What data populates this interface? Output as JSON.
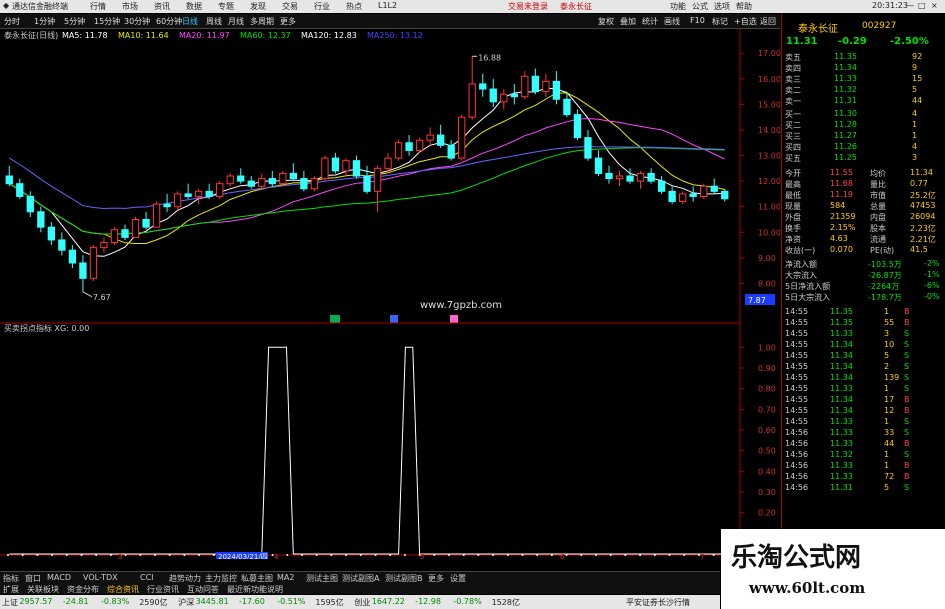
{
  "topbar": {
    "app_name": "通达信金融终端",
    "menus": [
      "行情",
      "市场",
      "资讯",
      "数据",
      "专题",
      "发现",
      "交易",
      "行业",
      "热点"
    ],
    "build": "L1L2",
    "links": [
      "交易未登录",
      "泰永长征"
    ],
    "right_menus": [
      "功能",
      "公式",
      "选项",
      "帮助"
    ],
    "time": "20:31:23",
    "window_controls": [
      "—",
      "□",
      "×"
    ]
  },
  "tabs": {
    "items": [
      "分时",
      "1分钟",
      "5分钟",
      "15分钟",
      "30分钟",
      "60分钟",
      "日线",
      "周线",
      "月线",
      "多周期",
      "更多"
    ],
    "right_items": [
      "复权",
      "叠加",
      "统计",
      "画线",
      "F10",
      "标记",
      "+自选",
      "返回"
    ]
  },
  "chart_header": {
    "title": "泰永长征(日线)",
    "ma": [
      {
        "label": "MA5: 11.78",
        "color": "#ffffff"
      },
      {
        "label": "MA10: 11.64",
        "color": "#e8e800"
      },
      {
        "label": "MA20: 11.97",
        "color": "#ff44ff"
      },
      {
        "label": "MA60: 12.37",
        "color": "#00e000"
      },
      {
        "label": "MA120: 12.83",
        "color": "#ffffff"
      },
      {
        "label": "MA250: 13.12",
        "color": "#4444ff"
      }
    ]
  },
  "indicator_header": {
    "title": "买卖拐点指标",
    "value": "XG: 0.00"
  },
  "price_labels": {
    "high": "16.88",
    "low": "7.67",
    "cursor_price": "7.87"
  },
  "site_watermark": "www.7gpzb.com",
  "time_axis": {
    "start": "2024年",
    "cursor_date": "2024/03/21/四",
    "ticks": [
      "3",
      "4",
      "5",
      "6",
      "7"
    ]
  },
  "price_axis": [
    "17.00",
    "16.00",
    "15.00",
    "14.00",
    "13.00",
    "12.00",
    "11.00",
    "10.00",
    "9.00",
    "8.00"
  ],
  "indicator_axis": [
    "1.00",
    "0.90",
    "0.80",
    "0.70",
    "0.60",
    "0.50",
    "0.40",
    "0.30",
    "0.20",
    "0.10"
  ],
  "chart_data": {
    "type": "candlestick",
    "price_ylim": [
      7.0,
      17.4
    ],
    "ohlc": [
      [
        12.2,
        12.6,
        11.8,
        11.9
      ],
      [
        11.9,
        12.1,
        11.3,
        11.4
      ],
      [
        11.4,
        11.6,
        10.6,
        10.8
      ],
      [
        10.8,
        11.0,
        10.0,
        10.2
      ],
      [
        10.2,
        10.4,
        9.5,
        9.7
      ],
      [
        9.7,
        10.0,
        9.1,
        9.3
      ],
      [
        9.3,
        9.5,
        8.6,
        8.8
      ],
      [
        8.8,
        9.1,
        7.67,
        8.2
      ],
      [
        8.2,
        9.5,
        8.1,
        9.4
      ],
      [
        9.4,
        9.8,
        9.2,
        9.6
      ],
      [
        9.6,
        10.2,
        9.5,
        10.1
      ],
      [
        10.1,
        10.3,
        9.7,
        9.8
      ],
      [
        9.8,
        10.6,
        9.8,
        10.5
      ],
      [
        10.5,
        10.8,
        10.1,
        10.2
      ],
      [
        10.2,
        11.2,
        10.2,
        11.1
      ],
      [
        11.1,
        11.5,
        10.8,
        11.0
      ],
      [
        11.0,
        11.6,
        10.9,
        11.5
      ],
      [
        11.5,
        11.9,
        11.3,
        11.4
      ],
      [
        11.4,
        11.7,
        11.1,
        11.6
      ],
      [
        11.6,
        11.9,
        11.3,
        11.4
      ],
      [
        11.4,
        12.0,
        11.3,
        11.9
      ],
      [
        11.9,
        12.3,
        11.8,
        12.2
      ],
      [
        12.2,
        12.5,
        11.9,
        12.0
      ],
      [
        12.0,
        12.2,
        11.7,
        11.8
      ],
      [
        11.8,
        12.3,
        11.7,
        12.1
      ],
      [
        12.1,
        12.4,
        11.8,
        11.9
      ],
      [
        11.9,
        12.4,
        11.8,
        12.3
      ],
      [
        12.3,
        12.7,
        12.0,
        12.1
      ],
      [
        12.1,
        12.4,
        11.6,
        11.7
      ],
      [
        11.7,
        12.2,
        11.6,
        12.1
      ],
      [
        12.1,
        13.0,
        12.0,
        12.9
      ],
      [
        12.9,
        13.1,
        12.3,
        12.4
      ],
      [
        12.4,
        12.9,
        12.2,
        12.8
      ],
      [
        12.8,
        13.0,
        12.1,
        12.2
      ],
      [
        12.2,
        12.6,
        11.5,
        11.6
      ],
      [
        11.6,
        12.6,
        10.8,
        12.5
      ],
      [
        12.5,
        13.1,
        12.3,
        12.9
      ],
      [
        12.9,
        13.6,
        12.8,
        13.5
      ],
      [
        13.5,
        13.8,
        13.0,
        13.2
      ],
      [
        13.2,
        13.7,
        13.1,
        13.6
      ],
      [
        13.6,
        14.1,
        13.4,
        13.8
      ],
      [
        13.8,
        14.2,
        13.3,
        13.4
      ],
      [
        13.4,
        13.6,
        12.8,
        12.9
      ],
      [
        12.9,
        14.6,
        12.8,
        14.5
      ],
      [
        14.5,
        16.88,
        14.4,
        15.8
      ],
      [
        15.8,
        16.2,
        15.3,
        15.6
      ],
      [
        15.6,
        16.0,
        14.9,
        15.1
      ],
      [
        15.1,
        15.6,
        14.8,
        15.4
      ],
      [
        15.4,
        15.8,
        15.0,
        15.3
      ],
      [
        15.3,
        16.3,
        15.2,
        16.1
      ],
      [
        16.1,
        16.4,
        15.4,
        15.5
      ],
      [
        15.5,
        16.2,
        15.3,
        15.9
      ],
      [
        15.9,
        16.3,
        15.0,
        15.2
      ],
      [
        15.2,
        15.5,
        14.5,
        14.6
      ],
      [
        14.6,
        14.8,
        13.6,
        13.7
      ],
      [
        13.7,
        14.0,
        12.8,
        12.9
      ],
      [
        12.9,
        13.2,
        12.2,
        12.3
      ],
      [
        12.3,
        12.6,
        11.9,
        12.1
      ],
      [
        12.1,
        12.4,
        11.8,
        12.2
      ],
      [
        12.2,
        12.5,
        11.9,
        12.0
      ],
      [
        12.0,
        12.4,
        11.7,
        12.3
      ],
      [
        12.3,
        12.5,
        11.9,
        12.0
      ],
      [
        12.0,
        12.2,
        11.5,
        11.6
      ],
      [
        11.6,
        11.8,
        11.1,
        11.2
      ],
      [
        11.2,
        11.6,
        11.1,
        11.5
      ],
      [
        11.5,
        11.8,
        11.2,
        11.4
      ],
      [
        11.4,
        11.9,
        11.3,
        11.8
      ],
      [
        11.8,
        12.1,
        11.5,
        11.6
      ],
      [
        11.6,
        11.7,
        11.2,
        11.31
      ]
    ],
    "indicator_ylim": [
      0,
      1.05
    ],
    "indicator_signals": [
      0,
      0,
      0,
      0,
      0,
      0,
      0,
      0,
      0,
      0,
      0,
      0,
      0,
      0,
      0,
      0,
      0,
      0,
      0,
      0,
      0,
      0,
      0,
      0,
      0,
      1,
      1,
      0,
      0,
      0,
      0,
      0,
      0,
      0,
      0,
      0,
      0,
      0,
      1,
      0,
      0,
      0,
      0,
      0,
      0,
      0,
      0,
      0,
      0,
      0,
      0,
      0,
      0,
      0,
      0,
      0,
      0,
      0,
      0,
      0,
      0,
      0,
      0,
      0,
      0,
      0,
      0,
      0,
      0
    ]
  },
  "quote": {
    "name": "泰永长征",
    "code": "002927",
    "price": "11.31",
    "change": "-0.29",
    "pct": "-2.50%",
    "asks": [
      {
        "label": "卖五",
        "price": "11.35",
        "vol": "92"
      },
      {
        "label": "卖四",
        "price": "11.34",
        "vol": "9"
      },
      {
        "label": "卖三",
        "price": "11.33",
        "vol": "15"
      },
      {
        "label": "卖二",
        "price": "11.32",
        "vol": "5"
      },
      {
        "label": "卖一",
        "price": "11.31",
        "vol": "44"
      }
    ],
    "bids": [
      {
        "label": "买一",
        "price": "11.30",
        "vol": "4"
      },
      {
        "label": "买二",
        "price": "11.28",
        "vol": "1"
      },
      {
        "label": "买三",
        "price": "11.27",
        "vol": "1"
      },
      {
        "label": "买四",
        "price": "11.26",
        "vol": "4"
      },
      {
        "label": "买五",
        "price": "11.25",
        "vol": "3"
      }
    ],
    "stats": [
      [
        "今开",
        "11.55",
        "均价",
        "11.34"
      ],
      [
        "最高",
        "11.68",
        "量比",
        "0.77"
      ],
      [
        "最低",
        "11.19",
        "市值",
        "25.2亿"
      ],
      [
        "现量",
        "584",
        "总量",
        "47453"
      ],
      [
        "外盘",
        "21359",
        "内盘",
        "26094"
      ],
      [
        "换手",
        "2.15%",
        "股本",
        "2.23亿"
      ],
      [
        "净资",
        "4.63",
        "流通",
        "2.21亿"
      ],
      [
        "收益(一)",
        "0.070",
        "PE(动)",
        "41.5"
      ]
    ],
    "flows": [
      {
        "label": "净流入额",
        "value": "-103.5万",
        "pct": "-2%"
      },
      {
        "label": "大宗流入",
        "value": "-26.87万",
        "pct": "-1%"
      },
      {
        "label": "5日净流入额",
        "value": "-2264万",
        "pct": "-6%"
      },
      {
        "label": "5日大宗流入",
        "value": "-178.7万",
        "pct": "-0%"
      }
    ],
    "ticks": [
      {
        "time": "14:55",
        "price": "11.35",
        "vol": "1",
        "side": "B"
      },
      {
        "time": "14:55",
        "price": "11.35",
        "vol": "55",
        "side": "B"
      },
      {
        "time": "14:55",
        "price": "11.33",
        "vol": "3",
        "side": "S"
      },
      {
        "time": "14:55",
        "price": "11.34",
        "vol": "10",
        "side": "S"
      },
      {
        "time": "14:55",
        "price": "11.34",
        "vol": "5",
        "side": "S"
      },
      {
        "time": "14:55",
        "price": "11.34",
        "vol": "2",
        "side": "S"
      },
      {
        "time": "14:55",
        "price": "11.34",
        "vol": "139",
        "side": "S"
      },
      {
        "time": "14:55",
        "price": "11.33",
        "vol": "1",
        "side": "S"
      },
      {
        "time": "14:55",
        "price": "11.34",
        "vol": "17",
        "side": "B"
      },
      {
        "time": "14:55",
        "price": "11.34",
        "vol": "12",
        "side": "B"
      },
      {
        "time": "14:55",
        "price": "11.33",
        "vol": "1",
        "side": "S"
      },
      {
        "time": "14:56",
        "price": "11.33",
        "vol": "33",
        "side": "S"
      },
      {
        "time": "14:56",
        "price": "11.33",
        "vol": "44",
        "side": "B"
      },
      {
        "time": "14:56",
        "price": "11.32",
        "vol": "1",
        "side": "S"
      },
      {
        "time": "14:56",
        "price": "11.33",
        "vol": "1",
        "side": "B"
      },
      {
        "time": "14:56",
        "price": "11.33",
        "vol": "72",
        "side": "B"
      },
      {
        "time": "14:56",
        "price": "11.31",
        "vol": "5",
        "side": "S"
      }
    ]
  },
  "bottom_tabs": [
    "指标",
    "窗口",
    "MACD",
    "VOL-TDX",
    "CCI",
    "趋势动力",
    "主力监控",
    "私募主图",
    "MA2",
    "测试主图",
    "测试副图A",
    "测试副图B",
    "更多",
    "设置"
  ],
  "bottom_tabs2": [
    "扩展",
    "关联板块",
    "资金分布",
    "综合资讯",
    "行业资讯",
    "互动问答",
    "最近新功能说明"
  ],
  "statusbar": {
    "indices": [
      {
        "name": "上证",
        "value": "2957.57",
        "chg": "-24.81",
        "pct": "-0.83%",
        "amt": "2590亿"
      },
      {
        "name": "沪深",
        "value": "3445.81",
        "chg": "-17.60",
        "pct": "-0.51%",
        "amt": "1595亿"
      },
      {
        "name": "创业",
        "value": "1647.22",
        "chg": "-12.98",
        "pct": "-0.78%",
        "amt": "1528亿"
      }
    ],
    "broker": "平安证券长沙行情"
  },
  "corner_watermark": {
    "title": "乐淘公式网",
    "url": "www.60lt.com"
  }
}
